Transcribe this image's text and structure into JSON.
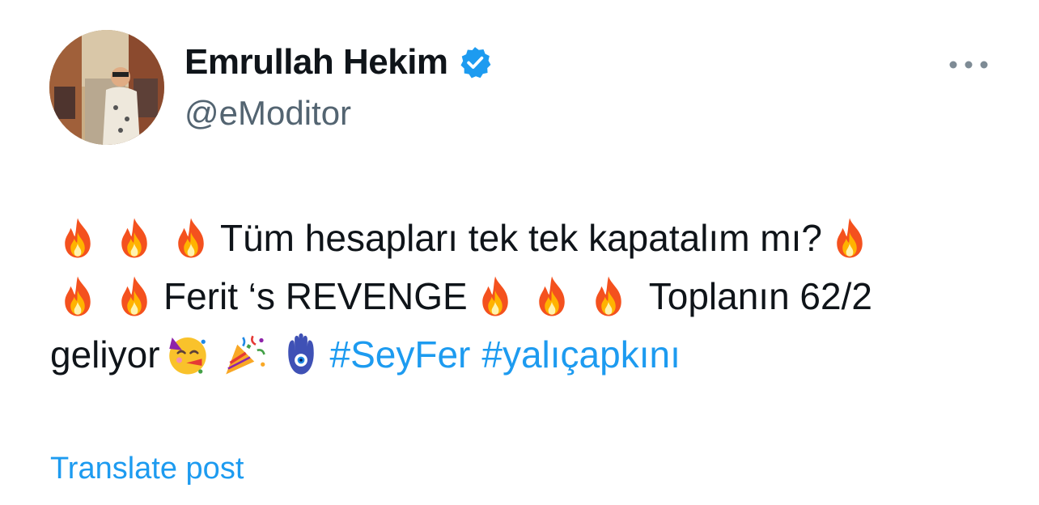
{
  "author": {
    "name": "Emrullah Hekim",
    "handle": "@eModitor",
    "verified": true
  },
  "tweet": {
    "line1": {
      "text": "Tüm hesapları tek tek kapatalım mı?"
    },
    "line2": {
      "text_a": "Ferit ‘s REVENGE",
      "text_b": "Toplanın 62/2"
    },
    "line3": {
      "text": "geliyor",
      "hashtag1": "#SeyFer",
      "hashtag2": "#yalıçapkını"
    }
  },
  "translate_label": "Translate post",
  "emoji_icons": [
    "fire-icon",
    "partying-face-icon",
    "party-popper-icon",
    "hamsa-icon"
  ],
  "colors": {
    "link": "#1d9bf0",
    "verified": "#1d9bf0",
    "handle": "#536471",
    "text": "#0f1419"
  }
}
